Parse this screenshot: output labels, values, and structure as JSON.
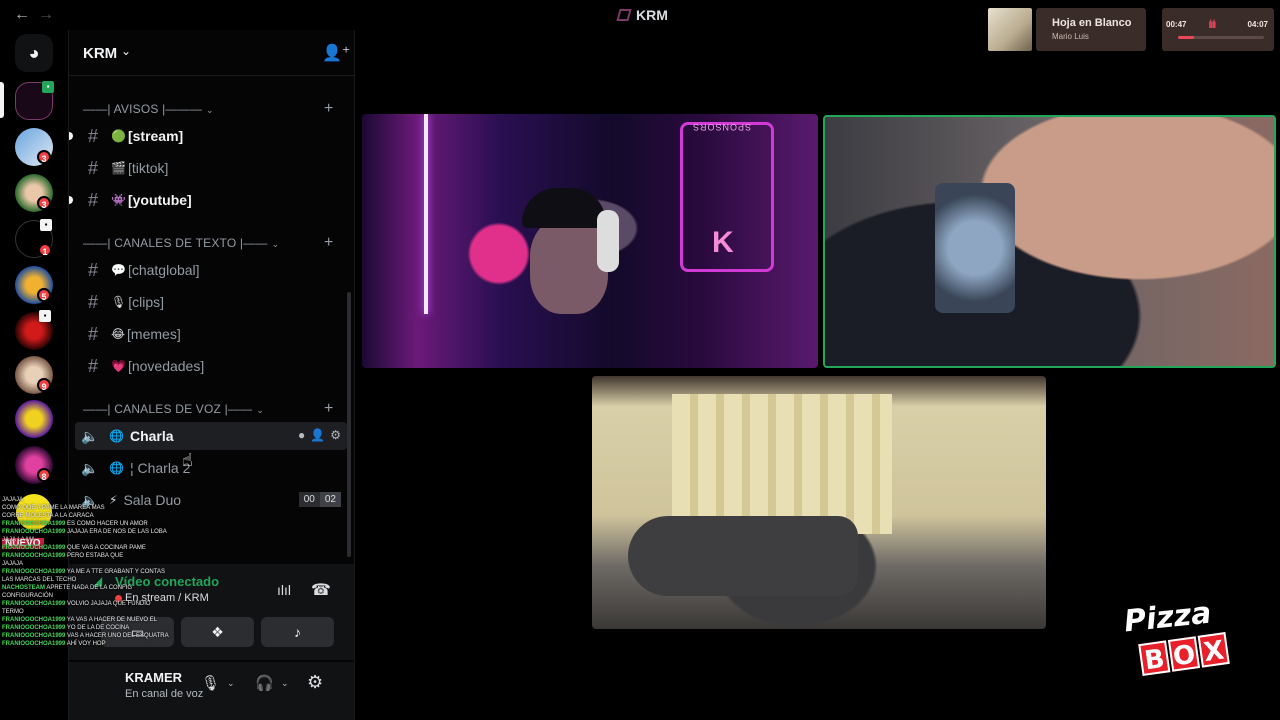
{
  "window": {
    "title": "KRM"
  },
  "music": {
    "title": "Hoja en Blanco",
    "artist": "Mario Luis",
    "time_current": "00:47",
    "time_total": "04:07",
    "progress": 0.19
  },
  "rail": {
    "badges": [
      "3",
      "3",
      "1",
      "5",
      "9",
      "8"
    ]
  },
  "sidebar": {
    "server_name": "KRM",
    "categories": {
      "avisos": "——| AVISOS |———",
      "texto": "——| CANALES DE TEXTO |——",
      "voz": "——| CANALES DE VOZ |——"
    },
    "channels_avisos": [
      {
        "emoji": "🟢",
        "name": "[stream]"
      },
      {
        "emoji": "🎬",
        "name": "[tiktok]"
      },
      {
        "emoji": "👾",
        "name": "[youtube]"
      }
    ],
    "channels_texto": [
      {
        "emoji": "💬",
        "name": "[chatglobal]"
      },
      {
        "emoji": "🎙",
        "name": "[clips]"
      },
      {
        "emoji": "😂",
        "name": "[memes]"
      },
      {
        "emoji": "💗",
        "name": "[novedades]"
      }
    ],
    "channels_voz": [
      {
        "emoji": "🌐",
        "name": "Charla"
      },
      {
        "emoji": "🌐",
        "name": "¦ Charla 2"
      },
      {
        "emoji": "⚡",
        "name": "Sala Duo",
        "limit_left": "00",
        "limit_right": "02"
      }
    ]
  },
  "voice": {
    "status": "Vídeo conectado",
    "channel": "En stream / KRM"
  },
  "user": {
    "name": "KRAMER",
    "status": "En canal de voz"
  },
  "chat_overlay": {
    "tag": "NUEVO",
    "lines": [
      {
        "who": "",
        "text": "JAJAJA"
      },
      {
        "who": "",
        "text": "COMO QUE A PAME LA MAREA MAS"
      },
      {
        "who": "",
        "text": "CORRE MOLESTA A LA CARACA"
      },
      {
        "who": "FRANIOOOCHOA1999",
        "text": "ES COMO HACER UN AMOR"
      },
      {
        "who": "FRANIOOOCHOA1999",
        "text": "JAJAJA ERA DE NOS DE LAS LOBA"
      },
      {
        "who": "",
        "text": "JAJA LA MA"
      },
      {
        "who": "FRANIOOOCHOA1999",
        "text": "QUE VAS A COCINAR PAME"
      },
      {
        "who": "FRANIOOOCHOA1999",
        "text": "PERO ESTABA QUE"
      },
      {
        "who": "",
        "text": "JAJAJA"
      },
      {
        "who": "FRANIOOOCHOA1999",
        "text": "YA ME A TTE GRABANT Y CONTAS"
      },
      {
        "who": "",
        "text": "LAS MARCAS DEL TECHO"
      },
      {
        "who": "NACHOSTEAM",
        "text": "APRETE NADA DE LA CONFIG"
      },
      {
        "who": "",
        "text": "CONFIGURACIÓN"
      },
      {
        "who": "FRANIOOOCHOA1999",
        "text": "VOLVIO JAJAJA QUE FUNDIO"
      },
      {
        "who": "",
        "text": "TERMO"
      },
      {
        "who": "FRANIOOOCHOA1999",
        "text": "YA VAS A HACER DE NUEVO EL"
      },
      {
        "who": "FRANIOOOCHOA1999",
        "text": "YO DE LA DE COCINA"
      },
      {
        "who": "FRANIOOOCHOA1999",
        "text": "VAS A HACER UNO DEL ESQUATRA"
      },
      {
        "who": "FRANIOOOCHOA1999",
        "text": "AHÍ VOY HOP"
      }
    ]
  },
  "tile1": {
    "sponsor_text": "SPONSORS",
    "neon_letter": "K"
  },
  "logo": {
    "top": "Pizza",
    "letters": [
      "B",
      "O",
      "X"
    ]
  },
  "colors": {
    "accent_green": "#23a55a",
    "badge_red": "#f23f43",
    "music_bg": "#3a2c28",
    "logo_red": "#e8202a"
  },
  "icons": [
    "back-arrow-icon",
    "forward-arrow-icon",
    "discord-icon",
    "invite-icon",
    "hash-icon",
    "speaker-icon",
    "chat-bubble-icon",
    "user-add-icon",
    "gear-icon",
    "noise-suppression-icon",
    "disconnect-icon",
    "screen-share-icon",
    "activity-icon",
    "soundboard-icon",
    "mic-icon",
    "headset-icon",
    "cursor-icon"
  ]
}
